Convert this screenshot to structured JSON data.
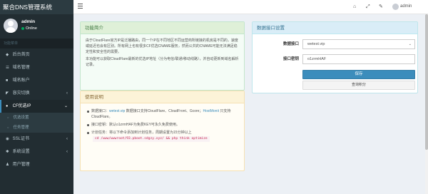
{
  "app": {
    "brand": "聚合DNS管理系统"
  },
  "user": {
    "name": "admin",
    "status": "Online"
  },
  "sidebar": {
    "header": "功能菜单",
    "items": [
      {
        "icon": "home-icon",
        "glyph": "◆",
        "label": "后台首页",
        "has_children": false
      },
      {
        "icon": "list-icon",
        "glyph": "☰",
        "label": "域名管理",
        "has_children": false
      },
      {
        "icon": "account-icon",
        "glyph": "■",
        "label": "域名账户",
        "has_children": false
      },
      {
        "icon": "tag-icon",
        "glyph": "◤",
        "label": "容灾切换",
        "has_children": true
      },
      {
        "icon": "cloud-icon",
        "glyph": "●",
        "label": "CF优选IP",
        "has_children": true,
        "active": true,
        "children": [
          {
            "label": "优选设置",
            "active": false
          },
          {
            "label": "任务管理",
            "active": false
          }
        ]
      },
      {
        "icon": "ssl-icon",
        "glyph": "◉",
        "label": "SSL证书",
        "has_children": true
      },
      {
        "icon": "settings-icon",
        "glyph": "✱",
        "label": "系统设置",
        "has_children": true
      },
      {
        "icon": "users-icon",
        "glyph": "♟",
        "label": "用户管理",
        "has_children": false
      }
    ]
  },
  "topbar": {
    "user_name": "admin",
    "icons": [
      "home-icon",
      "fullscreen-icon",
      "wrench-icon"
    ]
  },
  "intro": {
    "title": "功能简介",
    "p1": "由于CloudFlare官方IP是泛播路由，同一个IP在不同地区不同运营商所链接的机房是不同的，速度或延迟也会有区别。所有网上也有很多CF优选CNAME服务，然而公共的CNAME可能无法满足稳定性和安全性的需要。",
    "p2": "本功能可以获取CloudFlare最新的优选IP地址（分为电信/联通/移动线路），并自动更新到域名解析记录。"
  },
  "usage": {
    "title": "使用说明",
    "item1_pre": "数据接口：",
    "item1_link1": "wetest.vip",
    "item1_mid": " 数据接口支持CloudFlare、CloudFront、Gcore；",
    "item1_link2": "HostMonit",
    "item1_post": " 只支持CloudFlare。",
    "item2": "接口密钥：默认o1zrmHAF为免费KEY可永久免费使用。",
    "item3": "计划任务：将以下命令添加到计划任务，周期设置为15分钟以上",
    "command": "cd /www/wwwroot/93.pboot.sdgzy.xyz/ && php think optimize"
  },
  "form": {
    "title": "数据接口设置",
    "source_label": "数据接口",
    "source_value": "wetest.vip",
    "key_label": "接口密钥",
    "key_value": "o1zrmHAF",
    "save_label": "保存",
    "query_label": "查询积分"
  }
}
